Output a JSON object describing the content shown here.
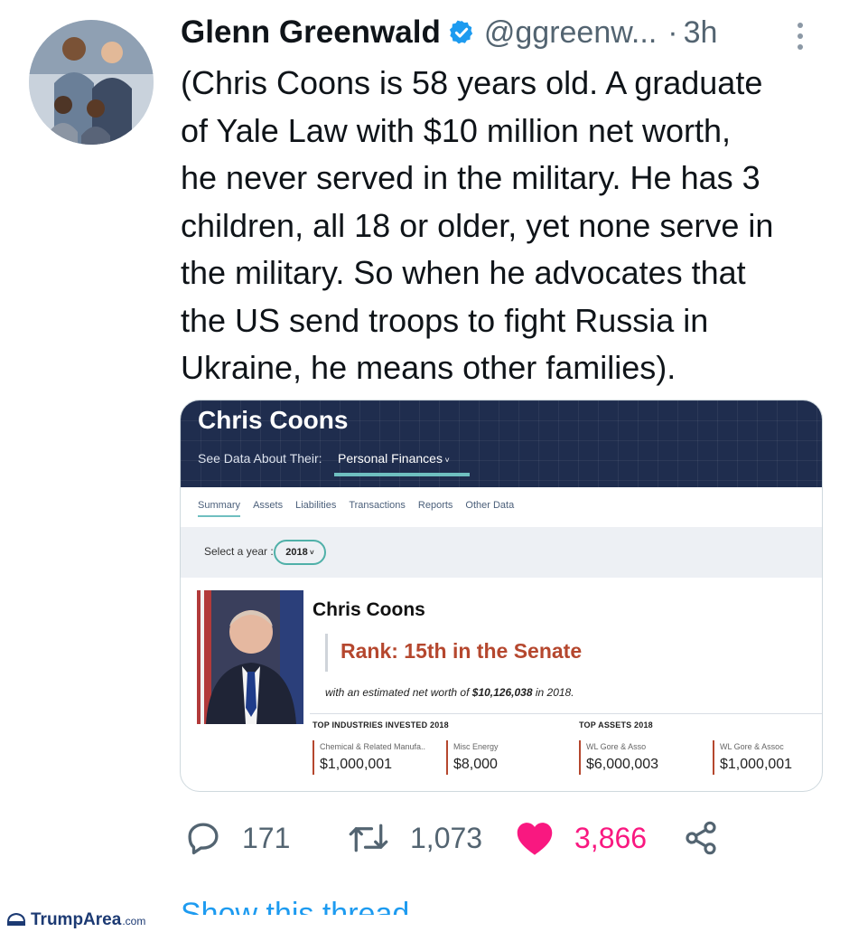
{
  "tweet": {
    "author_name": "Glenn Greenwald",
    "handle": "@ggreenw...",
    "separator": "·",
    "time_ago": "3h",
    "text_lines": [
      "(Chris Coons is 58 years old. A graduate",
      "of Yale Law with $10 million net worth,",
      "he never served in the military. He has 3",
      "children, all 18 or older, yet none serve in",
      "the military. So when he advocates that",
      "the US send troops to fight Russia in",
      "Ukraine, he means other families)."
    ]
  },
  "card": {
    "name": "Chris Coons",
    "see_data_label": "See Data About Their:",
    "finances_menu": "Personal Finances",
    "tabs": [
      "Summary",
      "Assets",
      "Liabilities",
      "Transactions",
      "Reports",
      "Other Data"
    ],
    "select_year_label": "Select a year :",
    "year": "2018",
    "profile_name": "Chris Coons",
    "rank": "Rank: 15th in the Senate",
    "networth_prefix": "with an estimated net worth of",
    "networth_value": "$10,126,038",
    "networth_suffix": "in 2018.",
    "top_industries_title": "TOP INDUSTRIES INVESTED 2018",
    "top_assets_title": "TOP ASSETS 2018",
    "industries": [
      {
        "label": "Chemical & Related Manufa..",
        "value": "$1,000,001"
      },
      {
        "label": "Misc Energy",
        "value": "$8,000"
      }
    ],
    "assets": [
      {
        "label": "WL Gore & Asso",
        "value": "$6,000,003"
      },
      {
        "label": "WL Gore & Assoc",
        "value": "$1,000,001"
      }
    ]
  },
  "actions": {
    "replies": "171",
    "retweets": "1,073",
    "likes": "3,866"
  },
  "footer": {
    "show_thread": "Show this thread",
    "watermark_main": "TrumpArea",
    "watermark_sub": ".com"
  },
  "colors": {
    "accent_blue": "#1d9bf0",
    "like_pink": "#f91880",
    "card_navy": "#1f2d4e",
    "rank_red": "#b5472e",
    "teal": "#6fbfc0"
  }
}
